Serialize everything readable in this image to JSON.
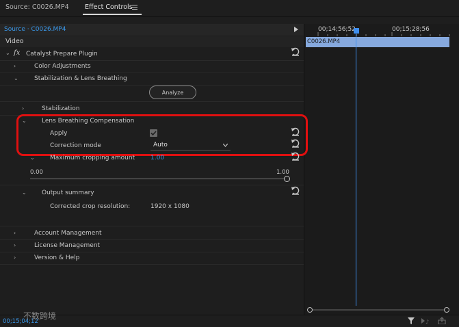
{
  "tabs": {
    "source": "Source: C0026.MP4",
    "effect_controls": "Effect Controls",
    "menu_icon": "hamburger-menu-icon"
  },
  "header": {
    "source_label": "Source · C0026.MP4",
    "collapse_icon": "play-right-icon"
  },
  "timeline": {
    "tc_start": "00;14;56;52",
    "tc_end": "00;15;28;56",
    "clip_label": "C0026.MP4",
    "clip_color": "#86a9de",
    "playhead_color": "#3f8ff0"
  },
  "video_label": "Video",
  "effect": {
    "fx_symbol": "fx",
    "name": "Catalyst Prepare Plugin",
    "color_adjustments": "Color Adjustments",
    "stabilization_lens": "Stabilization & Lens Breathing",
    "analyze_button": "Analyze",
    "stabilization": "Stabilization",
    "lens_breathing": "Lens Breathing Compensation",
    "apply_label": "Apply",
    "apply_checked": true,
    "correction_mode_label": "Correction mode",
    "correction_mode_value": "Auto",
    "max_crop_label": "Maximum cropping amount",
    "max_crop_value": "1.00",
    "slider_min": "0.00",
    "slider_max": "1.00",
    "slider_level": 1.0,
    "output_summary": "Output summary",
    "crop_res_label": "Corrected crop resolution:",
    "crop_res_value": "1920 x 1080",
    "account": "Account Management",
    "license": "License Management",
    "version": "Version & Help"
  },
  "footer": {
    "timecode": "00;15;04;12",
    "watermark": "不数跨境",
    "filter_icon": "filter-icon",
    "audio_icon": "audio-play-icon",
    "export_icon": "export-icon"
  },
  "highlight_color": "#e01010"
}
